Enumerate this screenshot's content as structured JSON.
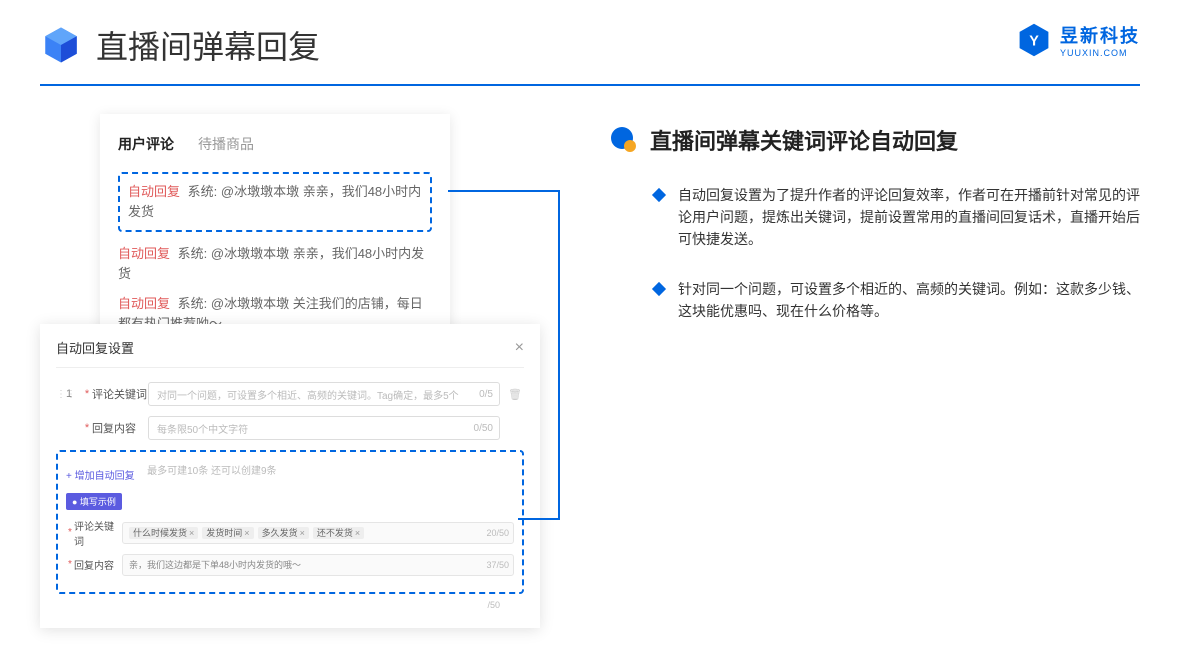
{
  "header": {
    "title": "直播间弹幕回复"
  },
  "logo": {
    "name": "昱新科技",
    "sub": "YUUXIN.COM"
  },
  "panel_comments": {
    "tab_active": "用户评论",
    "tab_inactive": "待播商品",
    "auto_reply_label": "自动回复",
    "sys_label": "系统:",
    "highlighted": "@冰墩墩本墩 亲亲，我们48小时内发货",
    "line2": "@冰墩墩本墩 亲亲，我们48小时内发货",
    "line3": "@冰墩墩本墩 关注我们的店铺，每日都有热门推荐呦～"
  },
  "panel_settings": {
    "title": "自动回复设置",
    "row_num": "1",
    "keyword_label": "评论关键词",
    "keyword_placeholder": "对同一个问题，可设置多个相近、高频的关键词。Tag确定，最多5个",
    "keyword_count": "0/5",
    "content_label": "回复内容",
    "content_placeholder": "每条限50个中文字符",
    "content_count": "0/50",
    "add_label": "+ 增加自动回复",
    "remain": "最多可建10条 还可以创建9条",
    "example_badge": "● 填写示例",
    "ex_keyword_label": "评论关键词",
    "ex_tags": [
      "什么时候发货",
      "发货时间",
      "多久发货",
      "还不发货"
    ],
    "ex_keyword_count": "20/50",
    "ex_content_label": "回复内容",
    "ex_content_value": "亲，我们这边都是下单48小时内发货的哦～",
    "ex_content_count": "37/50",
    "gray_count": "/50"
  },
  "right": {
    "section_title": "直播间弹幕关键词评论自动回复",
    "bullet1": "自动回复设置为了提升作者的评论回复效率，作者可在开播前针对常见的评论用户问题，提炼出关键词，提前设置常用的直播间回复话术，直播开始后可快捷发送。",
    "bullet2": "针对同一个问题，可设置多个相近的、高频的关键词。例如：这款多少钱、这块能优惠吗、现在什么价格等。"
  }
}
